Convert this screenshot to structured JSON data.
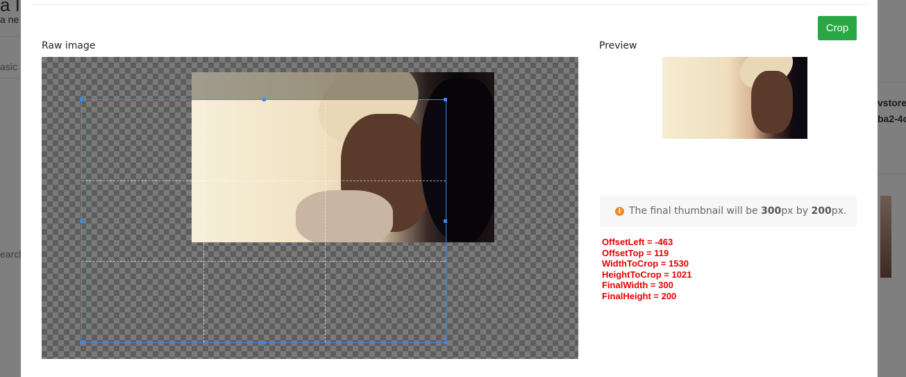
{
  "background_page": {
    "fragments": [
      "a I",
      "a ne",
      "asic",
      "earch",
      "vstore",
      "ba2-4c"
    ]
  },
  "toolbar": {
    "crop_label": "Crop"
  },
  "labels": {
    "raw_image": "Raw image",
    "preview": "Preview"
  },
  "info": {
    "icon": "info-circle-icon",
    "prefix": "The final thumbnail will be ",
    "width_value": "300",
    "unit1": "px by ",
    "height_value": "200",
    "unit2": "px."
  },
  "stats": {
    "offset_left": "OffsetLeft = -463",
    "offset_top": "OffsetTop = 119",
    "width_to_crop": "WidthToCrop = 1530",
    "height_to_crop": "HeightToCrop = 1021",
    "final_width": "FinalWidth = 300",
    "final_height": "FinalHeight = 200"
  },
  "colors": {
    "accent": "#28a745",
    "crop_border": "#3b8ae6",
    "stats_text": "#e60000",
    "info_icon": "#f08a24"
  }
}
